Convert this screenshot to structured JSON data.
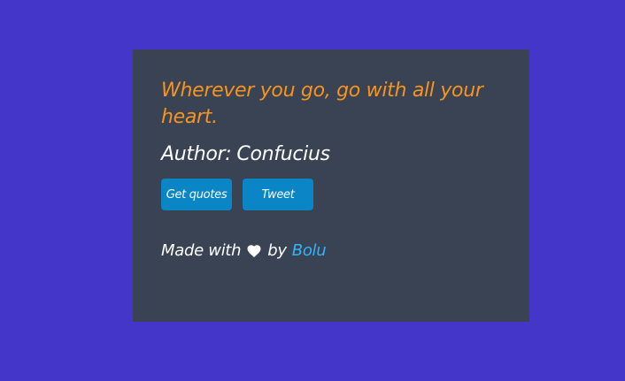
{
  "quote": {
    "text": "Wherever you go, go with all your heart."
  },
  "author": {
    "prefix": "Author:",
    "name": "Confucius"
  },
  "buttons": {
    "get_quotes": "Get quotes",
    "tweet": "Tweet"
  },
  "footer": {
    "made_with": "Made with",
    "by": "by",
    "author_link": "Bolu",
    "heart_icon": "heart-icon"
  },
  "colors": {
    "background": "#4336c8",
    "card": "#394353",
    "quote": "#f7941d",
    "button": "#0a86c7",
    "link": "#2fb4ff"
  }
}
